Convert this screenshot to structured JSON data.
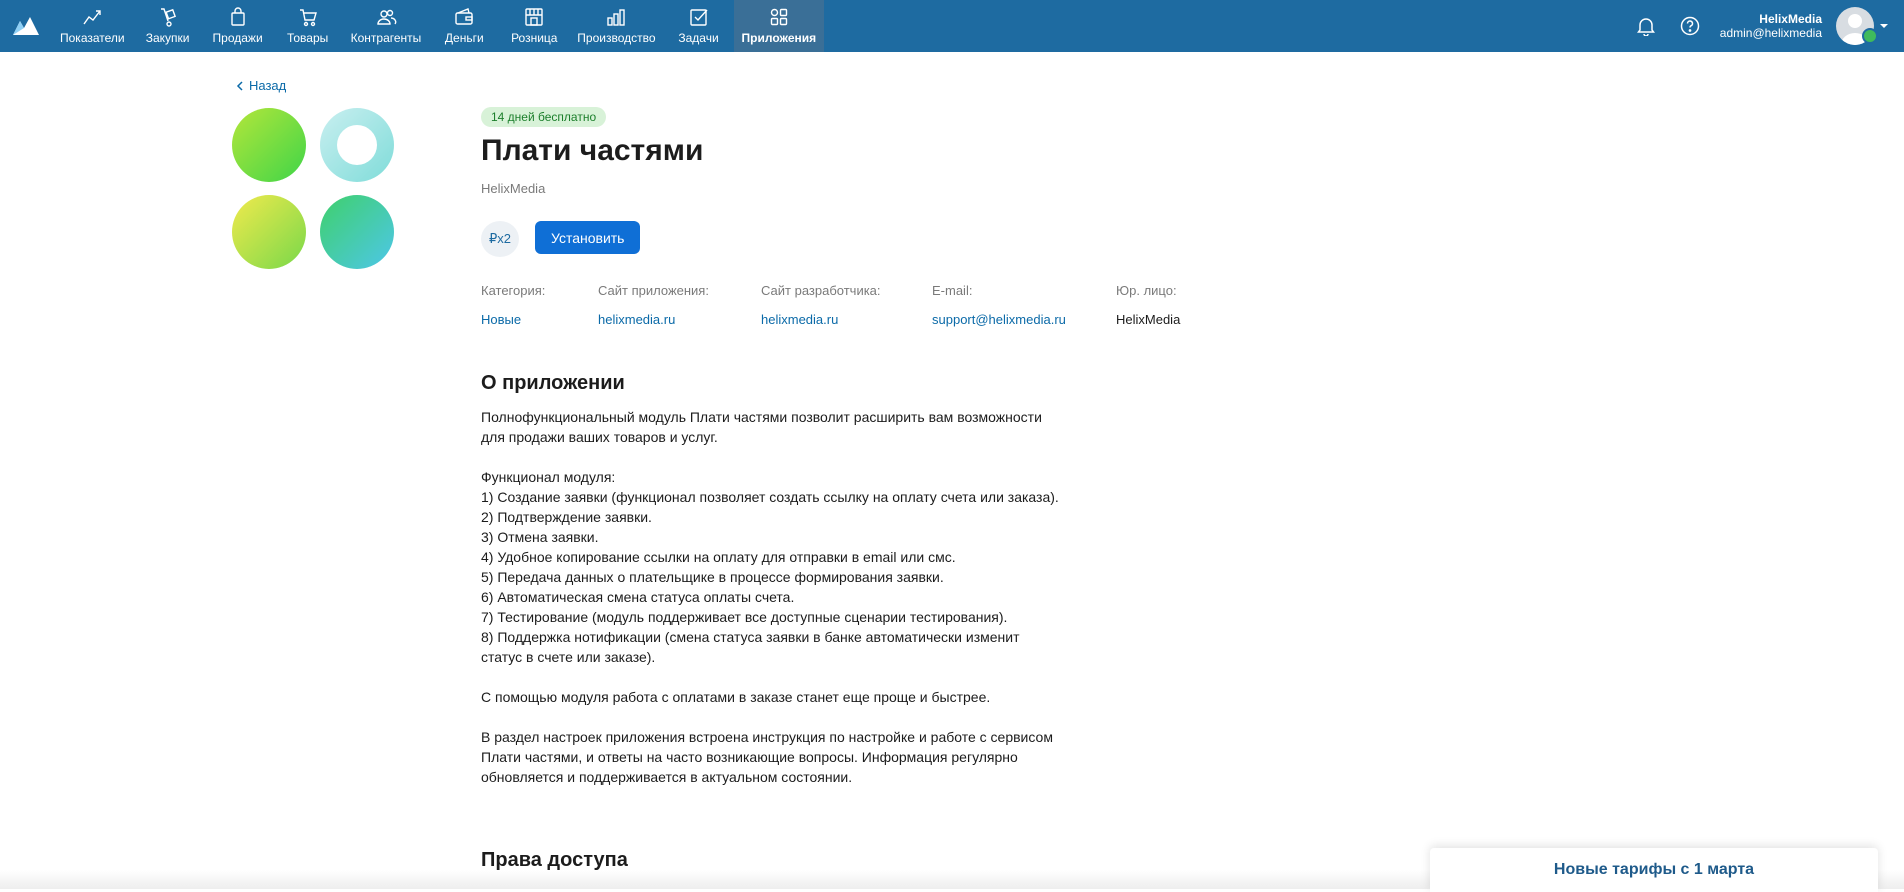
{
  "nav": {
    "items": [
      {
        "label": "Показатели",
        "icon": "chart-line-icon"
      },
      {
        "label": "Закупки",
        "icon": "hand-truck-icon"
      },
      {
        "label": "Продажи",
        "icon": "shopping-bag-icon"
      },
      {
        "label": "Товары",
        "icon": "cart-icon"
      },
      {
        "label": "Контрагенты",
        "icon": "people-icon"
      },
      {
        "label": "Деньги",
        "icon": "wallet-icon"
      },
      {
        "label": "Розница",
        "icon": "store-icon"
      },
      {
        "label": "Производство",
        "icon": "factory-icon"
      },
      {
        "label": "Задачи",
        "icon": "checkbox-icon"
      },
      {
        "label": "Приложения",
        "icon": "apps-grid-icon",
        "active": true
      }
    ]
  },
  "user": {
    "name": "HelixMedia",
    "email": "admin@helixmedia"
  },
  "back": {
    "label": "Назад"
  },
  "app": {
    "badge": "14 дней бесплатно",
    "title": "Плати частями",
    "vendor": "HelixMedia",
    "price": "₽x2",
    "install_label": "Установить"
  },
  "meta": {
    "category": {
      "label": "Категория:",
      "value": "Новые"
    },
    "app_site": {
      "label": "Сайт приложения:",
      "value": "helixmedia.ru"
    },
    "dev_site": {
      "label": "Сайт разработчика:",
      "value": "helixmedia.ru"
    },
    "email": {
      "label": "E-mail:",
      "value": "support@helixmedia.ru"
    },
    "legal": {
      "label": "Юр. лицо:",
      "value": "HelixMedia"
    }
  },
  "about": {
    "heading": "О приложении",
    "p1": "Полнофункциональный модуль Плати частями позволит расширить вам возможности для продажи ваших товаров и услуг.",
    "p2": "Функционал модуля:\n1) Создание заявки (функционал позволяет создать ссылку на оплату счета или заказа).\n2) Подтверждение заявки.\n3) Отмена заявки.\n4) Удобное копирование ссылки на оплату для отправки в email или смс.\n5) Передача данных о плательщике в процессе формирования заявки.\n6) Автоматическая смена статуса оплаты счета.\n7) Тестирование (модуль поддерживает все доступные сценарии тестирования).\n8) Поддержка нотификации (смена статуса заявки в банке автоматически изменит статус в счете или заказе).",
    "p3": "С помощью модуля работа с оплатами в заказе станет еще проще и быстрее.",
    "p4": "В раздел настроек приложения встроена инструкция по настройке и работе с сервисом Плати частями, и ответы на часто возникающие вопросы. Информация регулярно обновляется и поддерживается в актуальном состоянии."
  },
  "access": {
    "heading": "Права доступа"
  },
  "banner": {
    "label": "Новые тарифы с 1 марта"
  }
}
